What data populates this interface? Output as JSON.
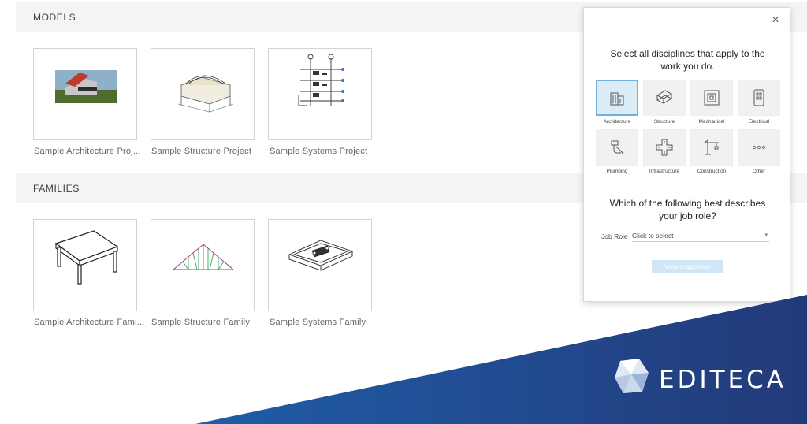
{
  "sections": {
    "models": {
      "title": "MODELS",
      "items": [
        {
          "label": "Sample Architecture Proj..."
        },
        {
          "label": "Sample Structure Project"
        },
        {
          "label": "Sample Systems Project"
        }
      ]
    },
    "families": {
      "title": "FAMILIES",
      "items": [
        {
          "label": "Sample Architecture Fami..."
        },
        {
          "label": "Sample Structure Family"
        },
        {
          "label": "Sample Systems Family"
        }
      ]
    }
  },
  "dialog": {
    "close_icon": "close-icon",
    "prompt_line1": "Select all disciplines that apply to the",
    "prompt_line2": "work you do.",
    "disciplines": [
      {
        "label": "Architecture",
        "icon": "building-icon",
        "selected": true
      },
      {
        "label": "Structure",
        "icon": "beam-icon",
        "selected": false
      },
      {
        "label": "Mechanical",
        "icon": "duct-icon",
        "selected": false
      },
      {
        "label": "Electrical",
        "icon": "panel-icon",
        "selected": false
      },
      {
        "label": "Plumbing",
        "icon": "faucet-icon",
        "selected": false
      },
      {
        "label": "Infrastructure",
        "icon": "road-junction-icon",
        "selected": false
      },
      {
        "label": "Construction",
        "icon": "crane-icon",
        "selected": false
      },
      {
        "label": "Other",
        "icon": "more-icon",
        "selected": false
      }
    ],
    "role_question_line1": "Which of the following best describes",
    "role_question_line2": "your job role?",
    "job_role_label": "Job Role",
    "job_role_value": "Click to select",
    "view_button": "View suggestion"
  },
  "brand": {
    "name": "EDITECA",
    "color": "#2a4a8e"
  }
}
